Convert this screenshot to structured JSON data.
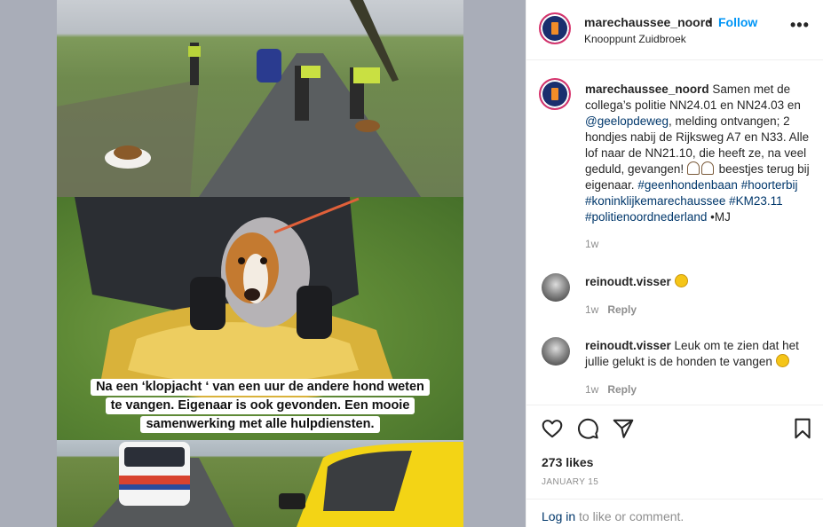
{
  "header": {
    "username": "marechaussee_noord",
    "separator": "•",
    "follow_label": "Follow",
    "location": "Knooppunt Zuidbroek",
    "more_label": "•••"
  },
  "media": {
    "overlay_lines": [
      "Na een ‘klopjacht ‘ van een uur de andere hond weten",
      "te vangen. Eigenaar is ook gevonden. Een mooie",
      "samenwerking met alle hulpdiensten."
    ]
  },
  "caption": {
    "username": "marechaussee_noord",
    "text_1": " Samen met de collega’s politie NN24.01 en NN24.03 en ",
    "mention": "@geelopdeweg",
    "text_2": ", melding ontvangen; 2 hondjes nabij de Rijksweg A7 en N33. Alle lof naar de NN21.10, die heeft ze, na veel geduld, gevangen! ",
    "text_3": " beestjes terug bij eigenaar. ",
    "hashtags": [
      "#geenhondenbaan",
      "#hoorterbij",
      "#koninklijkemarechaussee",
      "#KM23.11",
      "#politienoordnederland"
    ],
    "signoff": " •MJ",
    "time": "1w"
  },
  "comments": [
    {
      "username": "reinoudt.visser",
      "text": "",
      "time": "1w",
      "reply_label": "Reply"
    },
    {
      "username": "reinoudt.visser",
      "text": "Leuk om te zien dat het jullie gelukt is de honden te vangen",
      "time": "1w",
      "reply_label": "Reply"
    }
  ],
  "engagement": {
    "likes": "273 likes",
    "date": "JANUARY 15"
  },
  "footer": {
    "login_link": "Log in",
    "login_rest": " to like or comment."
  },
  "icons": {
    "like": "heart-icon",
    "comment": "speech-bubble-icon",
    "share": "paper-plane-icon",
    "save": "bookmark-icon",
    "emoji": "smiling-face-icon",
    "ghost": "ghost-icon"
  },
  "colors": {
    "accent": "#0095f6",
    "link": "#00376b",
    "muted": "#8e8e8e"
  }
}
